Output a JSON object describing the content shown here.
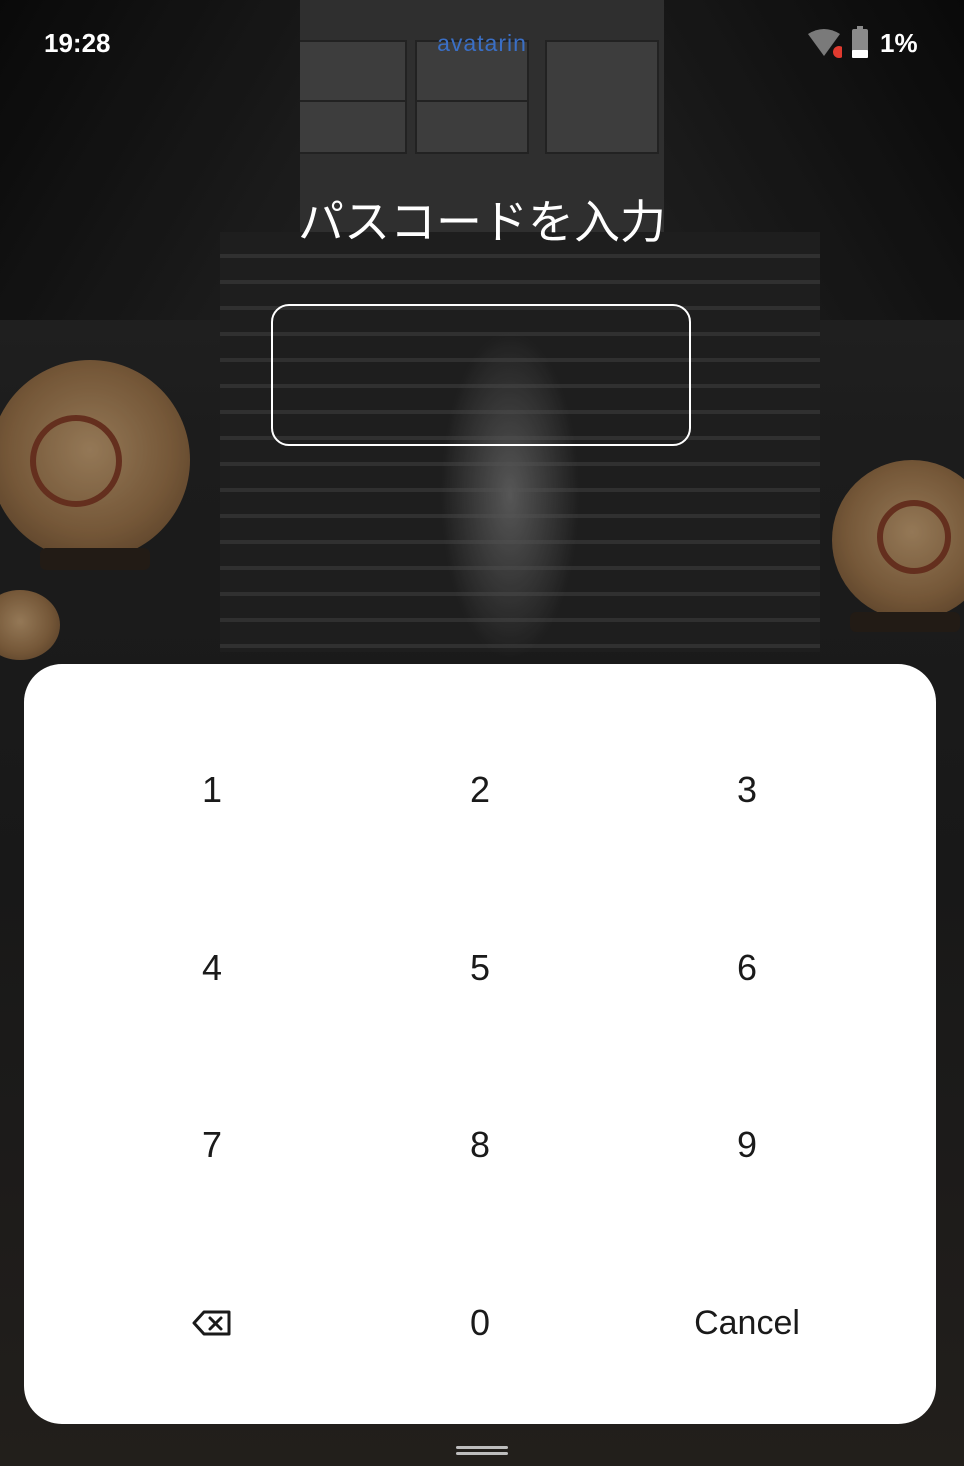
{
  "status_bar": {
    "time": "19:28",
    "brand": "avatarin",
    "battery_percent": "1%",
    "icons": [
      "wifi-icon",
      "battery-icon"
    ],
    "colors": {
      "brand": "#3a6fc6",
      "wifi_alert": "#e03a2f"
    }
  },
  "passcode": {
    "title": "パスコードを入力",
    "value": ""
  },
  "keypad": {
    "keys": {
      "k1": "1",
      "k2": "2",
      "k3": "3",
      "k4": "4",
      "k5": "5",
      "k6": "6",
      "k7": "7",
      "k8": "8",
      "k9": "9",
      "k0": "0",
      "cancel": "Cancel",
      "backspace_icon": "backspace-icon"
    }
  }
}
